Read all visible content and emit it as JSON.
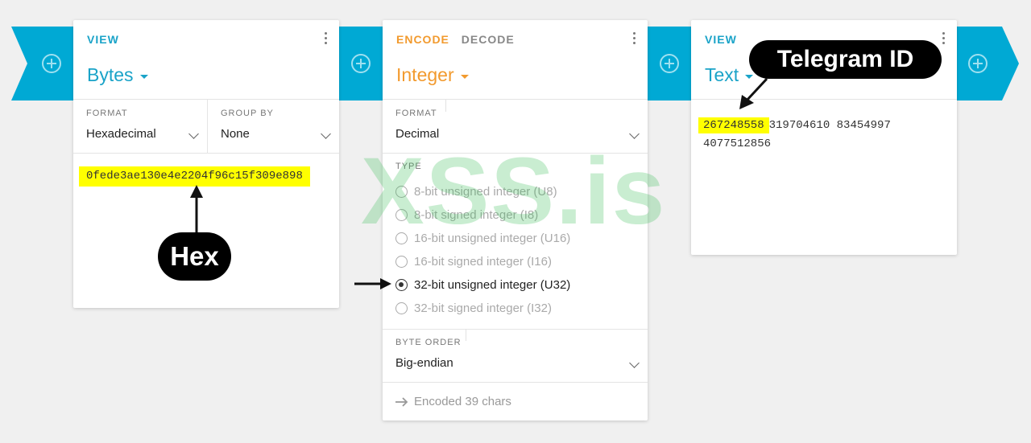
{
  "left_card": {
    "tab": "VIEW",
    "title": "Bytes",
    "format_label": "FORMAT",
    "format_value": "Hexadecimal",
    "group_label": "GROUP BY",
    "group_value": "None",
    "hex_value": "0fede3ae130e4e2204f96c15f309e898",
    "annotation": "Hex"
  },
  "middle_card": {
    "tab_encode": "ENCODE",
    "tab_decode": "DECODE",
    "title": "Integer",
    "format_label": "FORMAT",
    "format_value": "Decimal",
    "type_label": "TYPE",
    "types": [
      {
        "label": "8-bit unsigned integer (U8)",
        "selected": false
      },
      {
        "label": "8-bit signed integer (I8)",
        "selected": false
      },
      {
        "label": "16-bit unsigned integer (U16)",
        "selected": false
      },
      {
        "label": "16-bit signed integer (I16)",
        "selected": false
      },
      {
        "label": "32-bit unsigned integer (U32)",
        "selected": true
      },
      {
        "label": "32-bit signed integer (I32)",
        "selected": false
      }
    ],
    "byte_order_label": "BYTE ORDER",
    "byte_order_value": "Big-endian",
    "status": "Encoded 39 chars"
  },
  "right_card": {
    "tab": "VIEW",
    "title": "Text",
    "highlight_id": "267248558",
    "rest_line1": "319704610 83454997",
    "line2": "4077512856",
    "annotation": "Telegram ID"
  },
  "watermark": "XSS.is",
  "colors": {
    "connector": "#00a9d4",
    "view_accent": "#1aa3c8",
    "encode_accent": "#f29a2e",
    "highlight": "#ffff00"
  }
}
